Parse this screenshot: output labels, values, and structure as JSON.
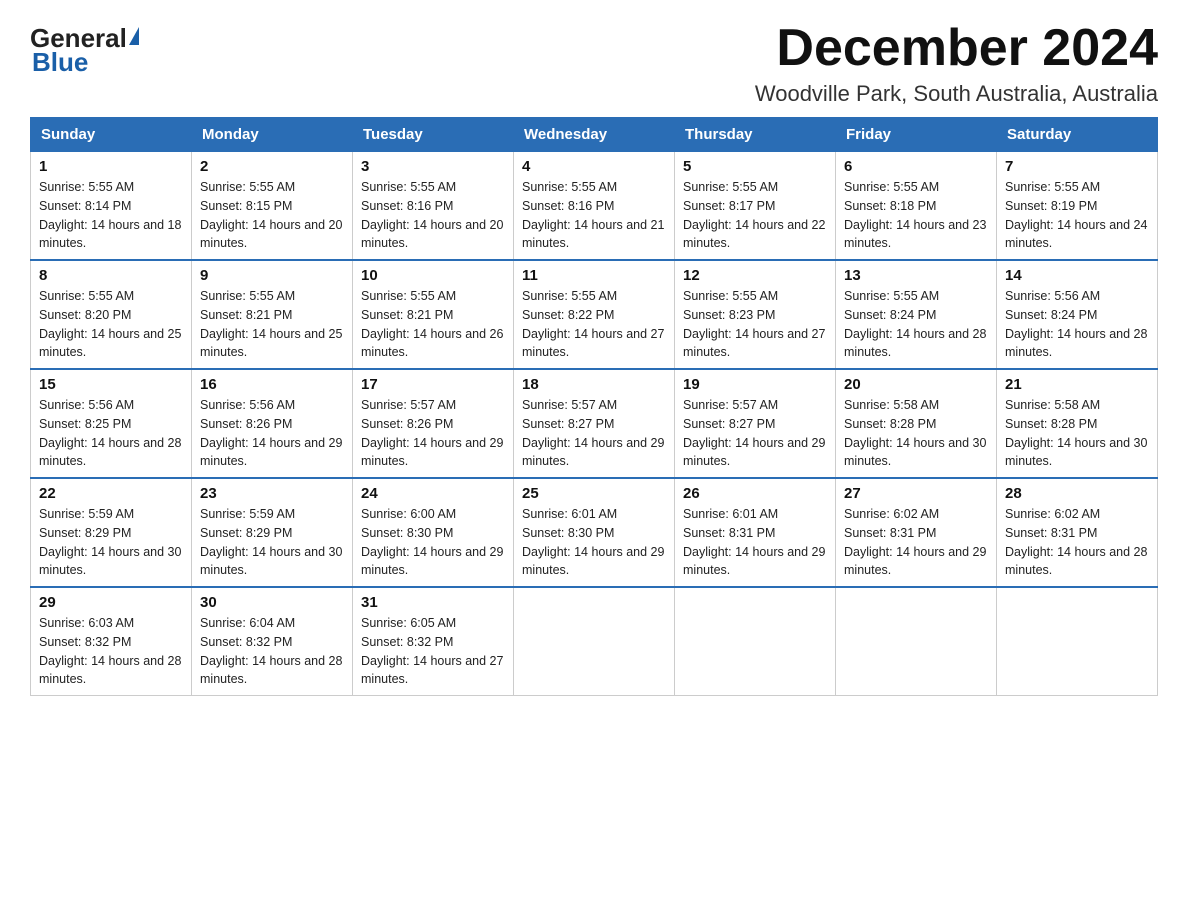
{
  "header": {
    "logo_general": "General",
    "logo_blue": "Blue",
    "month_title": "December 2024",
    "location": "Woodville Park, South Australia, Australia"
  },
  "weekdays": [
    "Sunday",
    "Monday",
    "Tuesday",
    "Wednesday",
    "Thursday",
    "Friday",
    "Saturday"
  ],
  "weeks": [
    [
      {
        "day": "1",
        "sunrise": "5:55 AM",
        "sunset": "8:14 PM",
        "daylight": "14 hours and 18 minutes."
      },
      {
        "day": "2",
        "sunrise": "5:55 AM",
        "sunset": "8:15 PM",
        "daylight": "14 hours and 20 minutes."
      },
      {
        "day": "3",
        "sunrise": "5:55 AM",
        "sunset": "8:16 PM",
        "daylight": "14 hours and 20 minutes."
      },
      {
        "day": "4",
        "sunrise": "5:55 AM",
        "sunset": "8:16 PM",
        "daylight": "14 hours and 21 minutes."
      },
      {
        "day": "5",
        "sunrise": "5:55 AM",
        "sunset": "8:17 PM",
        "daylight": "14 hours and 22 minutes."
      },
      {
        "day": "6",
        "sunrise": "5:55 AM",
        "sunset": "8:18 PM",
        "daylight": "14 hours and 23 minutes."
      },
      {
        "day": "7",
        "sunrise": "5:55 AM",
        "sunset": "8:19 PM",
        "daylight": "14 hours and 24 minutes."
      }
    ],
    [
      {
        "day": "8",
        "sunrise": "5:55 AM",
        "sunset": "8:20 PM",
        "daylight": "14 hours and 25 minutes."
      },
      {
        "day": "9",
        "sunrise": "5:55 AM",
        "sunset": "8:21 PM",
        "daylight": "14 hours and 25 minutes."
      },
      {
        "day": "10",
        "sunrise": "5:55 AM",
        "sunset": "8:21 PM",
        "daylight": "14 hours and 26 minutes."
      },
      {
        "day": "11",
        "sunrise": "5:55 AM",
        "sunset": "8:22 PM",
        "daylight": "14 hours and 27 minutes."
      },
      {
        "day": "12",
        "sunrise": "5:55 AM",
        "sunset": "8:23 PM",
        "daylight": "14 hours and 27 minutes."
      },
      {
        "day": "13",
        "sunrise": "5:55 AM",
        "sunset": "8:24 PM",
        "daylight": "14 hours and 28 minutes."
      },
      {
        "day": "14",
        "sunrise": "5:56 AM",
        "sunset": "8:24 PM",
        "daylight": "14 hours and 28 minutes."
      }
    ],
    [
      {
        "day": "15",
        "sunrise": "5:56 AM",
        "sunset": "8:25 PM",
        "daylight": "14 hours and 28 minutes."
      },
      {
        "day": "16",
        "sunrise": "5:56 AM",
        "sunset": "8:26 PM",
        "daylight": "14 hours and 29 minutes."
      },
      {
        "day": "17",
        "sunrise": "5:57 AM",
        "sunset": "8:26 PM",
        "daylight": "14 hours and 29 minutes."
      },
      {
        "day": "18",
        "sunrise": "5:57 AM",
        "sunset": "8:27 PM",
        "daylight": "14 hours and 29 minutes."
      },
      {
        "day": "19",
        "sunrise": "5:57 AM",
        "sunset": "8:27 PM",
        "daylight": "14 hours and 29 minutes."
      },
      {
        "day": "20",
        "sunrise": "5:58 AM",
        "sunset": "8:28 PM",
        "daylight": "14 hours and 30 minutes."
      },
      {
        "day": "21",
        "sunrise": "5:58 AM",
        "sunset": "8:28 PM",
        "daylight": "14 hours and 30 minutes."
      }
    ],
    [
      {
        "day": "22",
        "sunrise": "5:59 AM",
        "sunset": "8:29 PM",
        "daylight": "14 hours and 30 minutes."
      },
      {
        "day": "23",
        "sunrise": "5:59 AM",
        "sunset": "8:29 PM",
        "daylight": "14 hours and 30 minutes."
      },
      {
        "day": "24",
        "sunrise": "6:00 AM",
        "sunset": "8:30 PM",
        "daylight": "14 hours and 29 minutes."
      },
      {
        "day": "25",
        "sunrise": "6:01 AM",
        "sunset": "8:30 PM",
        "daylight": "14 hours and 29 minutes."
      },
      {
        "day": "26",
        "sunrise": "6:01 AM",
        "sunset": "8:31 PM",
        "daylight": "14 hours and 29 minutes."
      },
      {
        "day": "27",
        "sunrise": "6:02 AM",
        "sunset": "8:31 PM",
        "daylight": "14 hours and 29 minutes."
      },
      {
        "day": "28",
        "sunrise": "6:02 AM",
        "sunset": "8:31 PM",
        "daylight": "14 hours and 28 minutes."
      }
    ],
    [
      {
        "day": "29",
        "sunrise": "6:03 AM",
        "sunset": "8:32 PM",
        "daylight": "14 hours and 28 minutes."
      },
      {
        "day": "30",
        "sunrise": "6:04 AM",
        "sunset": "8:32 PM",
        "daylight": "14 hours and 28 minutes."
      },
      {
        "day": "31",
        "sunrise": "6:05 AM",
        "sunset": "8:32 PM",
        "daylight": "14 hours and 27 minutes."
      },
      null,
      null,
      null,
      null
    ]
  ],
  "labels": {
    "sunrise_prefix": "Sunrise: ",
    "sunset_prefix": "Sunset: ",
    "daylight_prefix": "Daylight: "
  }
}
